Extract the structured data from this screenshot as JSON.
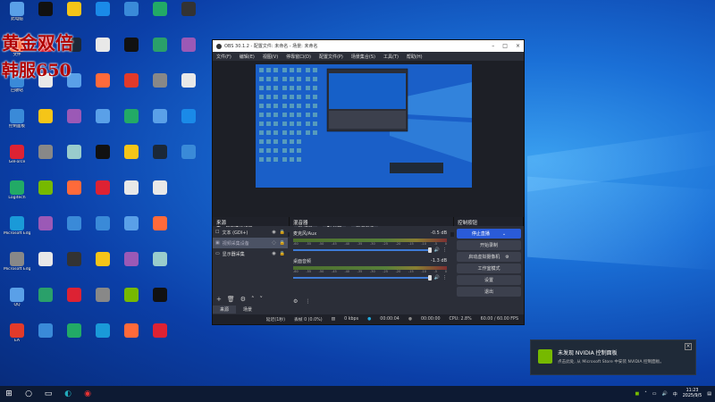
{
  "promo": {
    "line1": "黄金双倍",
    "line2": "韩服650"
  },
  "desktop_icons": [
    {
      "label": "此电脑",
      "color": "#5aa0e8"
    },
    {
      "label": "文件",
      "color": "#e8e8e8"
    },
    {
      "label": "回收站",
      "color": "#9cc"
    },
    {
      "label": "控制面板",
      "color": "#3a8ad8"
    },
    {
      "label": "GeForce",
      "color": "#76b900"
    },
    {
      "label": "Logitech",
      "color": "#333"
    },
    {
      "label": "Microsoft Edge",
      "color": "#1a9ad8"
    },
    {
      "label": "Microsoft Edge",
      "color": "#2aa06a"
    },
    {
      "label": "QQ",
      "color": "#1a8ae8"
    },
    {
      "label": "EA",
      "color": "#e23a2a"
    },
    {
      "label": "Steam",
      "color": "#1b2838"
    }
  ],
  "obs": {
    "title": "OBS 30.1.2 - 配置文件: 未命名 - 场景: 未命名",
    "menu": [
      "文件(F)",
      "编辑(E)",
      "视图(V)",
      "停靠窗口(D)",
      "配置文件(P)",
      "场景集合(S)",
      "工具(T)",
      "帮助(H)"
    ],
    "toolbar": {
      "source_name": "视频采集设备",
      "settings": "设置",
      "filters": "滤镜",
      "deactivate": "取消激活"
    },
    "docks": {
      "sources": "来源",
      "mixer": "混音器",
      "controls": "控制按钮"
    },
    "sources": [
      {
        "icon": "text-icon",
        "name": "文本 (GDI+)"
      },
      {
        "icon": "camera-icon",
        "name": "视频采集设备"
      },
      {
        "icon": "monitor-icon",
        "name": "显示器采集"
      }
    ],
    "source_tabs": {
      "sources": "来源",
      "scenes": "场景"
    },
    "mixer": [
      {
        "name": "麦克风/Aux",
        "db": "-0.5 dB"
      },
      {
        "name": "桌面音频",
        "db": "-1.3 dB"
      }
    ],
    "mixer_scale": [
      "-60",
      "-55",
      "-50",
      "-45",
      "-40",
      "-35",
      "-30",
      "-25",
      "-20",
      "-15",
      "-10",
      "-5",
      "0"
    ],
    "controls": [
      "停止直播",
      "开始录制",
      "启动虚拟摄像机",
      "工作室模式",
      "设置",
      "退出"
    ],
    "status": {
      "delay": "延迟(1秒)",
      "dropped": "丢帧 0 (0.0%)",
      "bitrate": "0 kbps",
      "live_time": "00:00:04",
      "rec_time": "00:00:00",
      "cpu": "CPU: 2.8%",
      "fps": "60.00 / 60.00 FPS"
    }
  },
  "notification": {
    "title": "未发现 NVIDIA 控制面板",
    "body": "点击此处, 从 Microsoft Store 中安装 NVIDIA 控制面板。"
  },
  "taskbar": {
    "input_method": "中",
    "time": "11:23",
    "date": "2025/9/5"
  }
}
